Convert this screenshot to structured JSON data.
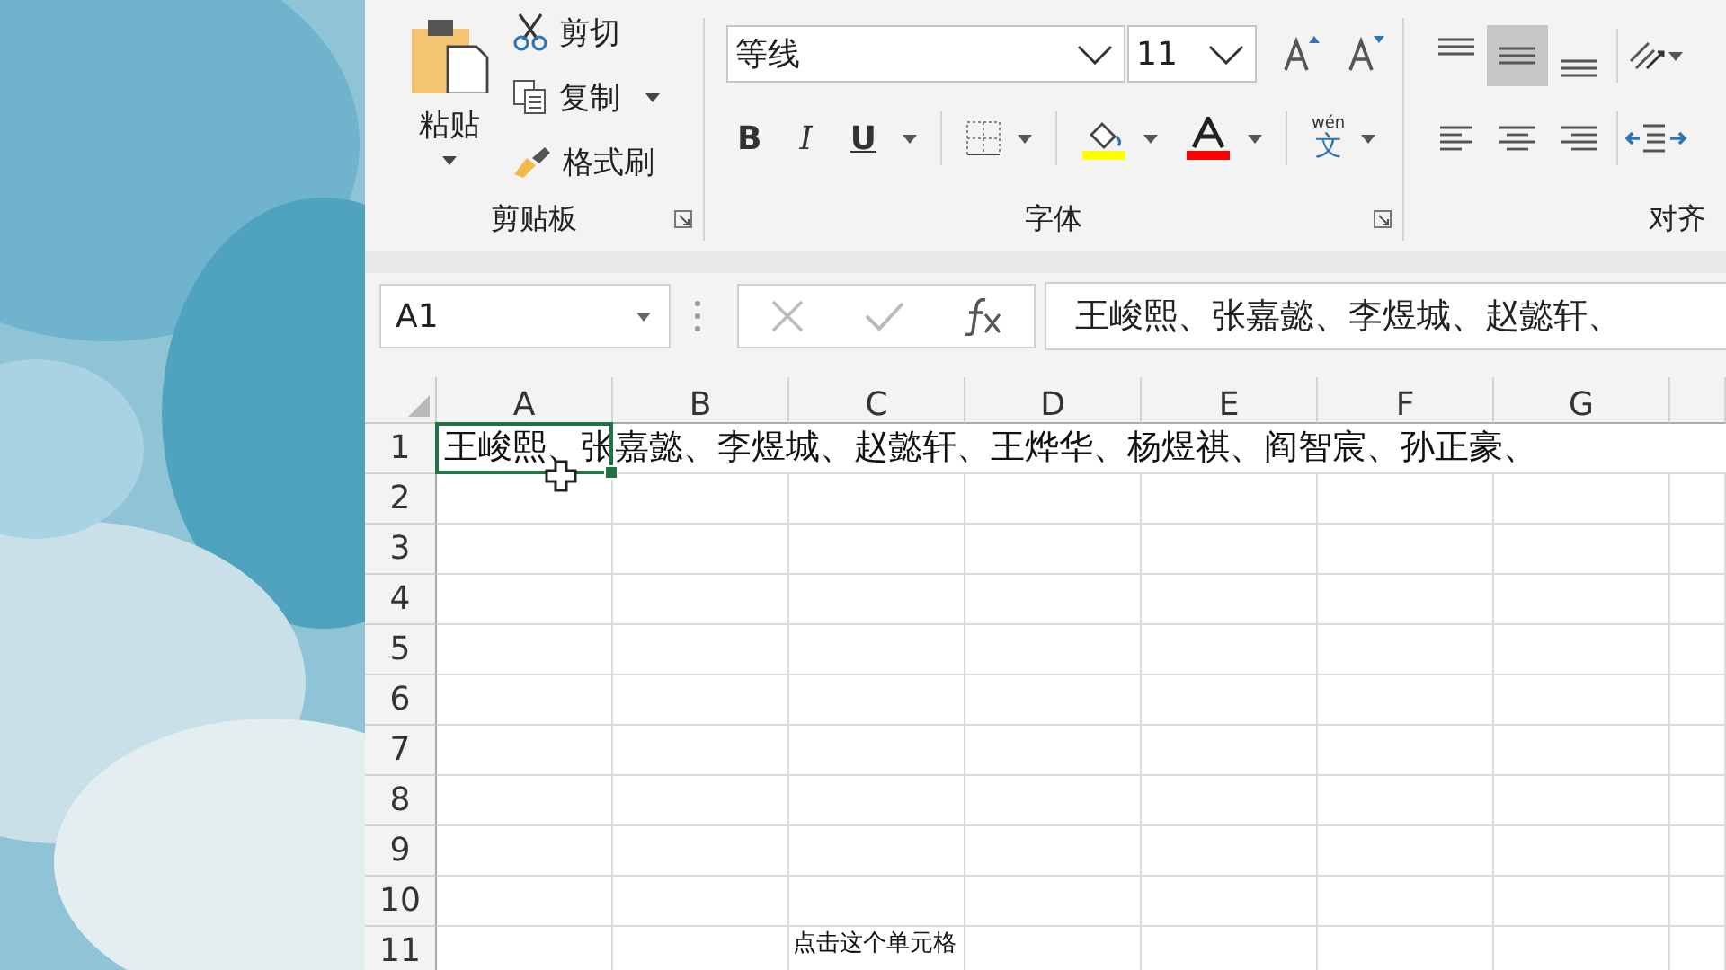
{
  "ribbon": {
    "groups": [
      {
        "kind": "clipboard",
        "label": "剪贴板",
        "paste": "粘贴",
        "items": [
          {
            "kind": "cut",
            "label": "剪切"
          },
          {
            "kind": "copy",
            "label": "复制"
          },
          {
            "kind": "format_painter",
            "label": "格式刷"
          }
        ]
      },
      {
        "kind": "font",
        "label": "字体",
        "font_name": "等线",
        "font_size": "11",
        "bold": "B",
        "italic": "I",
        "underline": "U",
        "phonetic_pinyin": "wén",
        "phonetic_char": "文"
      },
      {
        "kind": "alignment",
        "label": "对齐",
        "vertical": [
          {
            "kind": "top",
            "selected": false
          },
          {
            "kind": "middle",
            "selected": true
          },
          {
            "kind": "bottom",
            "selected": false
          }
        ],
        "horizontal": [
          {
            "kind": "left",
            "selected": false
          },
          {
            "kind": "center",
            "selected": false
          },
          {
            "kind": "right",
            "selected": false
          }
        ]
      }
    ]
  },
  "formula_bar": {
    "name_box": "A1",
    "value": "王峻熙、张嘉懿、李煜城、赵懿轩、"
  },
  "sheet": {
    "columns": [
      "A",
      "B",
      "C",
      "D",
      "E",
      "F",
      "G"
    ],
    "rows": [
      {
        "header": "1",
        "cells": [
          {
            "text": "王峻熙、张嘉懿、李煜城、赵懿轩、王烨华、杨煜祺、阎智宸、孙正豪、",
            "selected": true
          }
        ]
      },
      {
        "header": "2"
      },
      {
        "header": "3"
      },
      {
        "header": "4"
      },
      {
        "header": "5"
      },
      {
        "header": "6"
      },
      {
        "header": "7"
      },
      {
        "header": "8"
      },
      {
        "header": "9"
      },
      {
        "header": "10"
      },
      {
        "header": "11"
      }
    ]
  },
  "caption": "点击这个单元格"
}
